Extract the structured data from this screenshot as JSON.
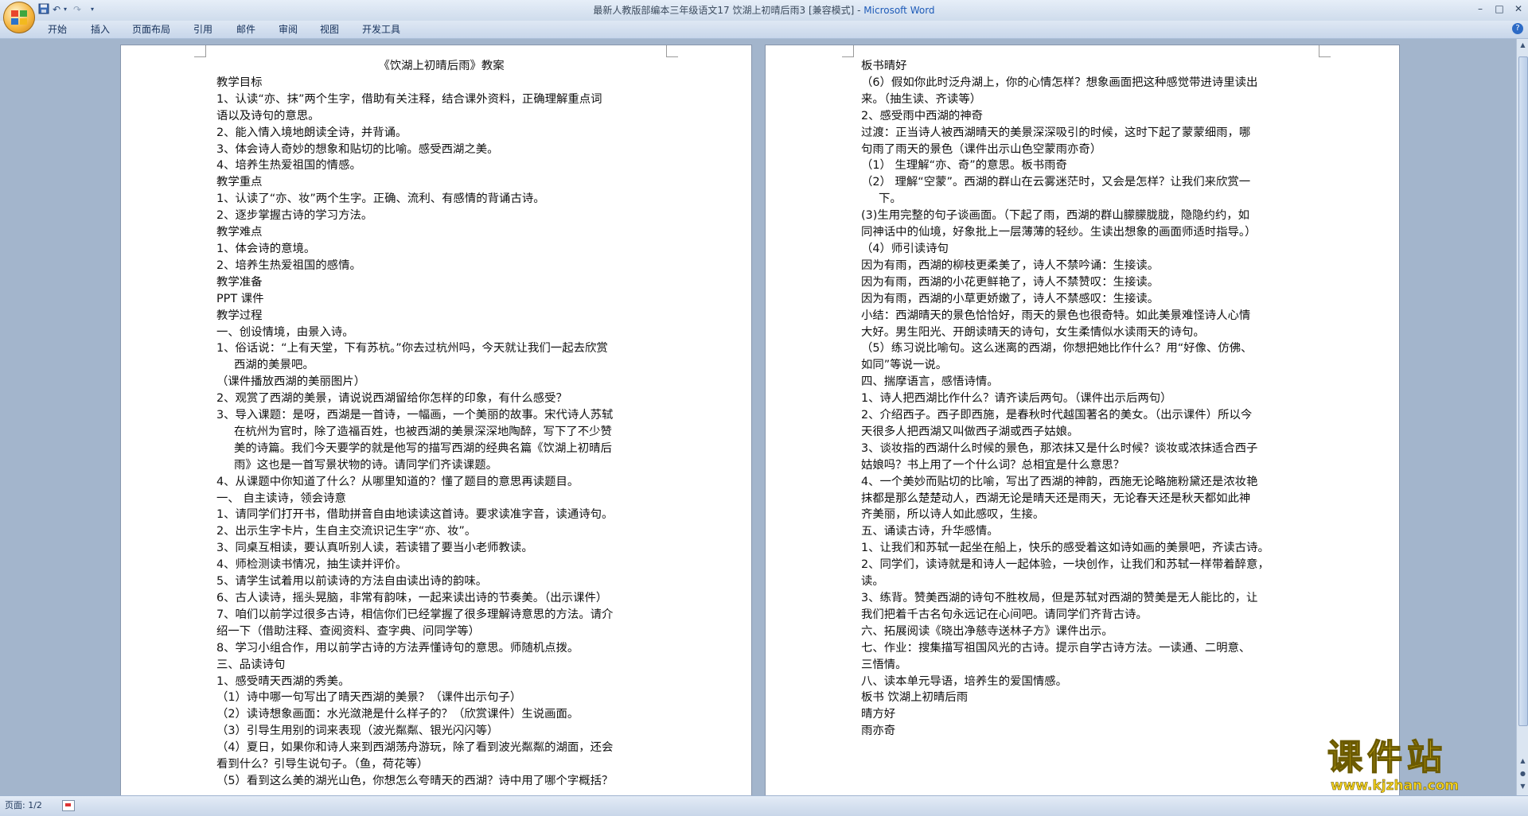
{
  "window": {
    "title_doc": "最新人教版部编本三年级语文17 饮湖上初晴后雨3 [兼容模式] - ",
    "title_app": "Microsoft Word"
  },
  "ribbon": {
    "tabs": [
      "开始",
      "插入",
      "页面布局",
      "引用",
      "邮件",
      "审阅",
      "视图",
      "开发工具"
    ]
  },
  "page1": {
    "lines": [
      {
        "t": "《饮湖上初晴后雨》教案",
        "s": "ctr"
      },
      {
        "t": "教学目标"
      },
      {
        "t": "1、认读“亦、抹”两个生字，借助有关注释，结合课外资料，正确理解重点词"
      },
      {
        "t": "语以及诗句的意思。"
      },
      {
        "t": "2、能入情入境地朗读全诗，并背诵。"
      },
      {
        "t": "3、体会诗人奇妙的想象和贴切的比喻。感受西湖之美。"
      },
      {
        "t": "4、培养生热爱祖国的情感。"
      },
      {
        "t": "教学重点"
      },
      {
        "t": "1、认读了“亦、妆”两个生字。正确、流利、有感情的背诵古诗。"
      },
      {
        "t": "2、逐步掌握古诗的学习方法。"
      },
      {
        "t": "教学难点"
      },
      {
        "t": "1、体会诗的意境。"
      },
      {
        "t": "2、培养生热爱祖国的感情。"
      },
      {
        "t": "教学准备"
      },
      {
        "t": "PPT 课件"
      },
      {
        "t": "教学过程"
      },
      {
        "t": "一、创设情境，由景入诗。"
      },
      {
        "t": "1、俗话说：“上有天堂，下有苏杭。”你去过杭州吗，今天就让我们一起去欣赏"
      },
      {
        "t": "西湖的美景吧。",
        "s": "ind"
      },
      {
        "t": "（课件播放西湖的美丽图片）"
      },
      {
        "t": "2、观赏了西湖的美景，请说说西湖留给你怎样的印象，有什么感受？"
      },
      {
        "t": "3、导入课题：是呀，西湖是一首诗，一幅画，一个美丽的故事。宋代诗人苏轼"
      },
      {
        "t": "在杭州为官时，除了造福百姓，也被西湖的美景深深地陶醉，写下了不少赞",
        "s": "ind"
      },
      {
        "t": "美的诗篇。我们今天要学的就是他写的描写西湖的经典名篇《饮湖上初晴后",
        "s": "ind"
      },
      {
        "t": "雨》这也是一首写景状物的诗。请同学们齐读课题。",
        "s": "ind"
      },
      {
        "t": "4、从课题中你知道了什么？从哪里知道的？懂了题目的意思再读题目。"
      },
      {
        "t": "一、  自主读诗，领会诗意"
      },
      {
        "t": "1、请同学们打开书，借助拼音自由地读读这首诗。要求读准字音，读通诗句。"
      },
      {
        "t": "2、出示生字卡片，生自主交流识记生字“亦、妆”。"
      },
      {
        "t": "3、同桌互相读，要认真听别人读，若读错了要当小老师教读。"
      },
      {
        "t": "4、师检测读书情况，抽生读并评价。"
      },
      {
        "t": "5、请学生试着用以前读诗的方法自由读出诗的韵味。"
      },
      {
        "t": "6、古人读诗，摇头晃脑，非常有韵味，一起来读出诗的节奏美。（出示课件）"
      },
      {
        "t": " 7、咱们以前学过很多古诗，相信你们已经掌握了很多理解诗意思的方法。请介"
      },
      {
        "t": "绍一下（借助注释、查阅资料、查字典、问同学等）"
      },
      {
        "t": " 8、学习小组合作，用以前学古诗的方法弄懂诗句的意思。师随机点拨。"
      },
      {
        "t": " 三、品读诗句"
      },
      {
        "t": " 1、感受晴天西湖的秀美。"
      },
      {
        "t": "  （1）诗中哪一句写出了晴天西湖的美景？（课件出示句子）"
      },
      {
        "t": "  （2）读诗想象画面：水光潋滟是什么样子的？（欣赏课件）生说画面。"
      },
      {
        "t": "  （3）引导生用别的词来表现（波光粼粼、银光闪闪等）"
      },
      {
        "t": "  （4）夏日，如果你和诗人来到西湖荡舟游玩，除了看到波光粼粼的湖面，还会"
      },
      {
        "t": "看到什么？引导生说句子。（鱼，荷花等）"
      },
      {
        "t": "  （5）看到这么美的湖光山色，你想怎么夸晴天的西湖？诗中用了哪个字概括？"
      }
    ]
  },
  "page2": {
    "lines": [
      {
        "t": "板书晴好"
      },
      {
        "t": "  （6）假如你此时泛舟湖上，你的心情怎样？想象画面把这种感觉带进诗里读出"
      },
      {
        "t": "来。（抽生读、齐读等）"
      },
      {
        "t": "  2、感受雨中西湖的神奇"
      },
      {
        "t": "  过渡：正当诗人被西湖晴天的美景深深吸引的时候，这时下起了蒙蒙细雨，哪"
      },
      {
        "t": "句雨了雨天的景色（课件出示山色空蒙雨亦奇）"
      },
      {
        "t": "  （1）  生理解“亦、奇”的意思。板书雨奇"
      },
      {
        "t": "  （2）  理解“空蒙”。西湖的群山在云雾迷茫时，又会是怎样？让我们来欣赏一"
      },
      {
        "t": "下。",
        "s": "ind"
      },
      {
        "t": "  (3)生用完整的句子谈画面。（下起了雨，西湖的群山朦朦胧胧，隐隐约约，如"
      },
      {
        "t": "  同神话中的仙境，好象批上一层薄薄的轻纱。生读出想象的画面师适时指导。）"
      },
      {
        "t": "  （4）师引读诗句"
      },
      {
        "t": "  因为有雨，西湖的柳枝更柔美了，诗人不禁吟诵：生接读。"
      },
      {
        "t": "  因为有雨，西湖的小花更鲜艳了，诗人不禁赞叹：生接读。"
      },
      {
        "t": "  因为有雨，西湖的小草更娇嫩了，诗人不禁感叹：生接读。"
      },
      {
        "t": "  小结：西湖晴天的景色恰恰好，雨天的景色也很奇特。如此美景难怪诗人心情"
      },
      {
        "t": "  大好。男生阳光、开朗读晴天的诗句，女生柔情似水读雨天的诗句。"
      },
      {
        "t": "  （5）练习说比喻句。这么迷离的西湖，你想把她比作什么？用“好像、仿佛、"
      },
      {
        "t": "  如同”等说一说。"
      },
      {
        "t": "  四、揣摩语言，感悟诗情。"
      },
      {
        "t": "  1、诗人把西湖比作什么？请齐读后两句。（课件出示后两句）"
      },
      {
        "t": "  2、介绍西子。西子即西施，是春秋时代越国著名的美女。（出示课件）所以今"
      },
      {
        "t": "  天很多人把西湖又叫做西子湖或西子姑娘。"
      },
      {
        "t": "  3、谈妆指的西湖什么时候的景色，那浓抹又是什么时候？谈妆或浓抹适合西子"
      },
      {
        "t": "  姑娘吗？书上用了一个什么词？总相宜是什么意思？"
      },
      {
        "t": "  4、一个美妙而贴切的比喻，写出了西湖的神韵，西施无论略施粉黛还是浓妆艳"
      },
      {
        "t": "  抹都是那么楚楚动人，西湖无论是晴天还是雨天，无论春天还是秋天都如此神"
      },
      {
        "t": "  齐美丽，所以诗人如此感叹，生接。"
      },
      {
        "t": "  五、诵读古诗，升华感情。"
      },
      {
        "t": "  1、让我们和苏轼一起坐在船上，快乐的感受着这如诗如画的美景吧，齐读古诗。"
      },
      {
        "t": "  2、同学们，读诗就是和诗人一起体验，一块创作，让我们和苏轼一样带着醉意，"
      },
      {
        "t": "  读。"
      },
      {
        "t": "  3、练背。赞美西湖的诗句不胜枚局，但是苏轼对西湖的赞美是无人能比的，让"
      },
      {
        "t": "  我们把着千古名句永远记在心间吧。请同学们齐背古诗。"
      },
      {
        "t": "  六、拓展阅读《晓出净慈寺送林子方》课件出示。"
      },
      {
        "t": "  七、作业：搜集描写祖国风光的古诗。提示自学古诗方法。一读通、二明意、"
      },
      {
        "t": "  三悟情。"
      },
      {
        "t": "  八、读本单元导语，培养生的爱国情感。"
      },
      {
        "t": "  板书        饮湖上初晴后雨"
      },
      {
        "t": "                  晴方好"
      },
      {
        "t": "                  雨亦奇"
      }
    ]
  },
  "statusbar": {
    "page_label": "页面: 1/2"
  },
  "watermark": {
    "main": "课件站",
    "url": "www.kjzhan.com"
  }
}
